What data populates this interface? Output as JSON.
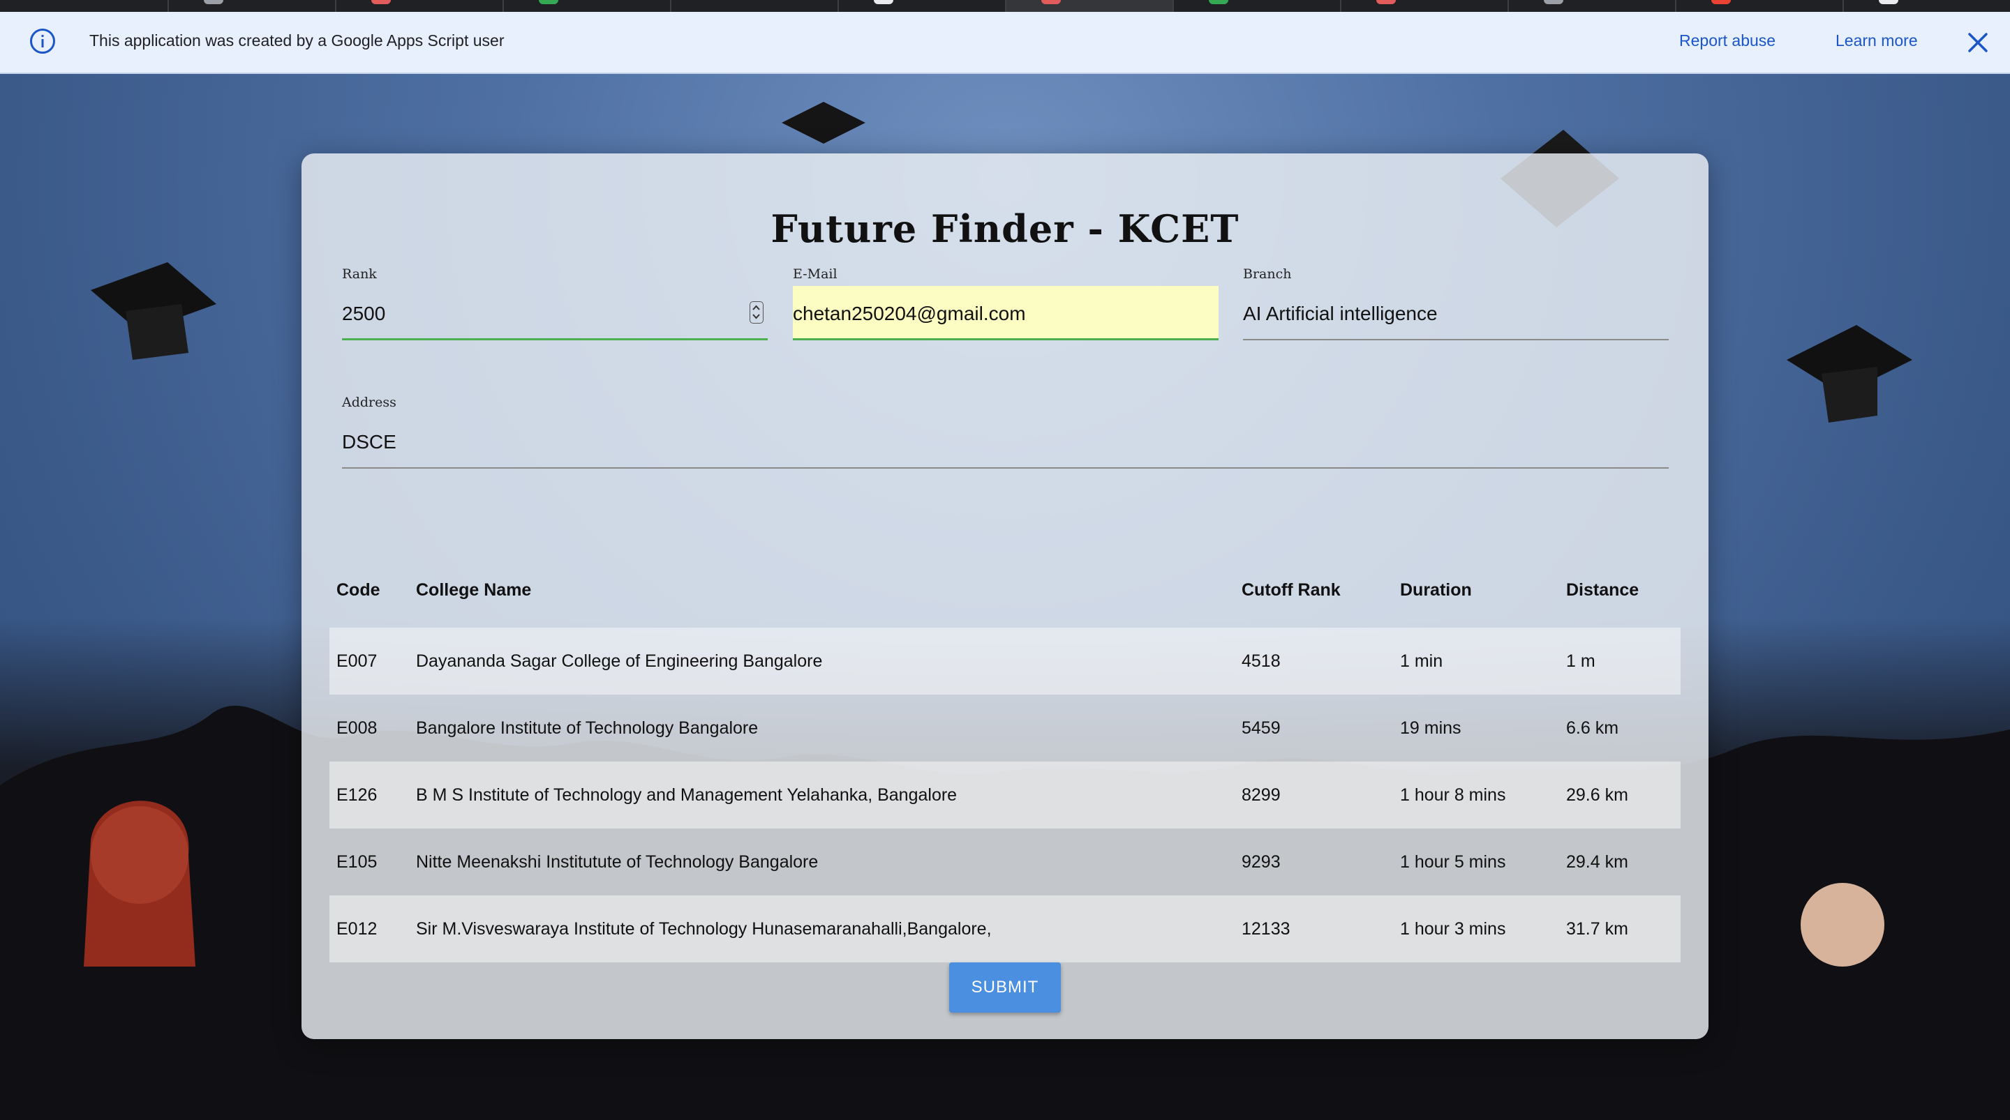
{
  "banner": {
    "message": "This application was created by a Google Apps Script user",
    "report_label": "Report abuse",
    "learn_label": "Learn more"
  },
  "form": {
    "title": "Future Finder - KCET",
    "rank_label": "Rank",
    "rank_value": "2500",
    "email_label": "E-Mail",
    "email_value": "chetan250204@gmail.com",
    "branch_label": "Branch",
    "branch_value": "AI Artificial intelligence",
    "address_label": "Address",
    "address_value": "DSCE"
  },
  "table": {
    "headers": [
      "Code",
      "College Name",
      "Cutoff Rank",
      "Duration",
      "Distance"
    ],
    "rows": [
      [
        "E007",
        "Dayananda Sagar College of Engineering Bangalore",
        "4518",
        "1 min",
        "1 m"
      ],
      [
        "E008",
        "Bangalore Institute of Technology Bangalore",
        "5459",
        "19 mins",
        "6.6 km"
      ],
      [
        "E126",
        "B M S Institute of Technology and Management Yelahanka, Bangalore",
        "8299",
        "1 hour 8 mins",
        "29.6 km"
      ],
      [
        "E105",
        "Nitte Meenakshi Institutute of Technology Bangalore",
        "9293",
        "1 hour 5 mins",
        "29.4 km"
      ],
      [
        "E012",
        "Sir M.Visveswaraya Institute of Technology Hunasemaranahalli,Bangalore,",
        "12133",
        "1 hour 3 mins",
        "31.7 km"
      ]
    ]
  },
  "submit_label": "SUBMIT"
}
